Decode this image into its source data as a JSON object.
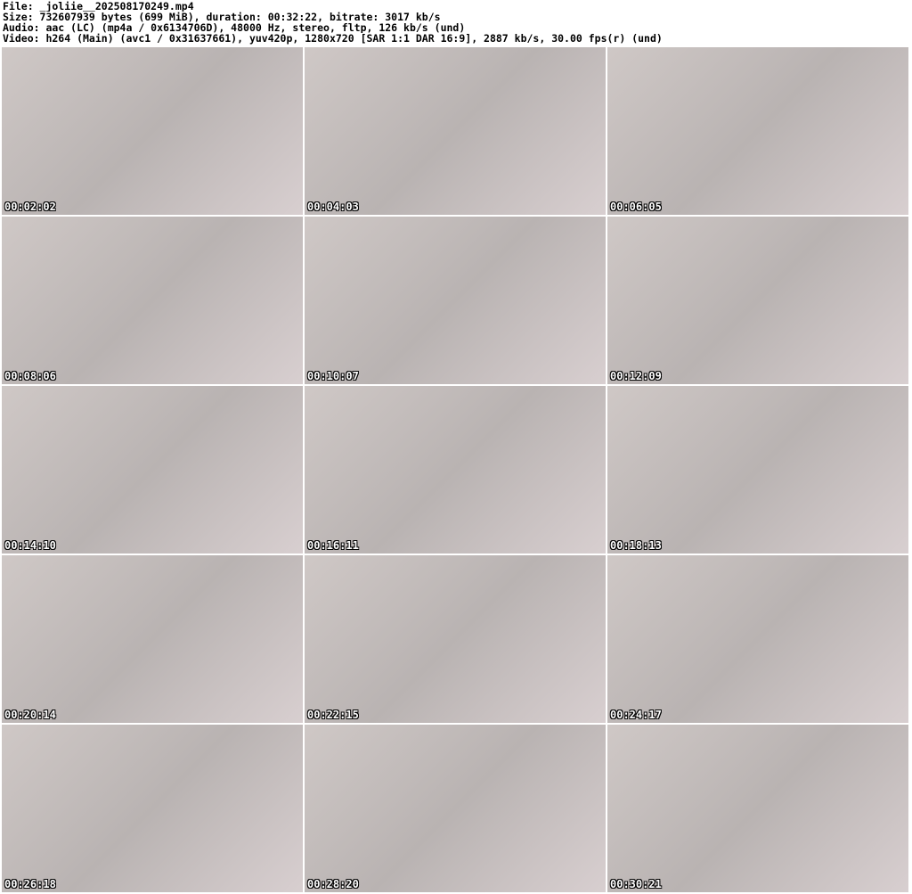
{
  "header": {
    "file": "File: _joliie__202508170249.mp4",
    "size": "Size: 732607939 bytes (699 MiB), duration: 00:32:22, bitrate: 3017 kb/s",
    "audio": "Audio: aac (LC) (mp4a / 0x6134706D), 48000 Hz, stereo, fltp, 126 kb/s (und)",
    "video": "Video: h264 (Main) (avc1 / 0x31637661), yuv420p, 1280x720 [SAR 1:1 DAR 16:9], 2887 kb/s, 30.00 fps(r) (und)"
  },
  "frames": [
    {
      "timestamp": "00:02:02"
    },
    {
      "timestamp": "00:04:03"
    },
    {
      "timestamp": "00:06:05"
    },
    {
      "timestamp": "00:08:06"
    },
    {
      "timestamp": "00:10:07"
    },
    {
      "timestamp": "00:12:09"
    },
    {
      "timestamp": "00:14:10"
    },
    {
      "timestamp": "00:16:11"
    },
    {
      "timestamp": "00:18:13"
    },
    {
      "timestamp": "00:20:14"
    },
    {
      "timestamp": "00:22:15"
    },
    {
      "timestamp": "00:24:17"
    },
    {
      "timestamp": "00:26:18"
    },
    {
      "timestamp": "00:28:20"
    },
    {
      "timestamp": "00:30:21"
    }
  ]
}
